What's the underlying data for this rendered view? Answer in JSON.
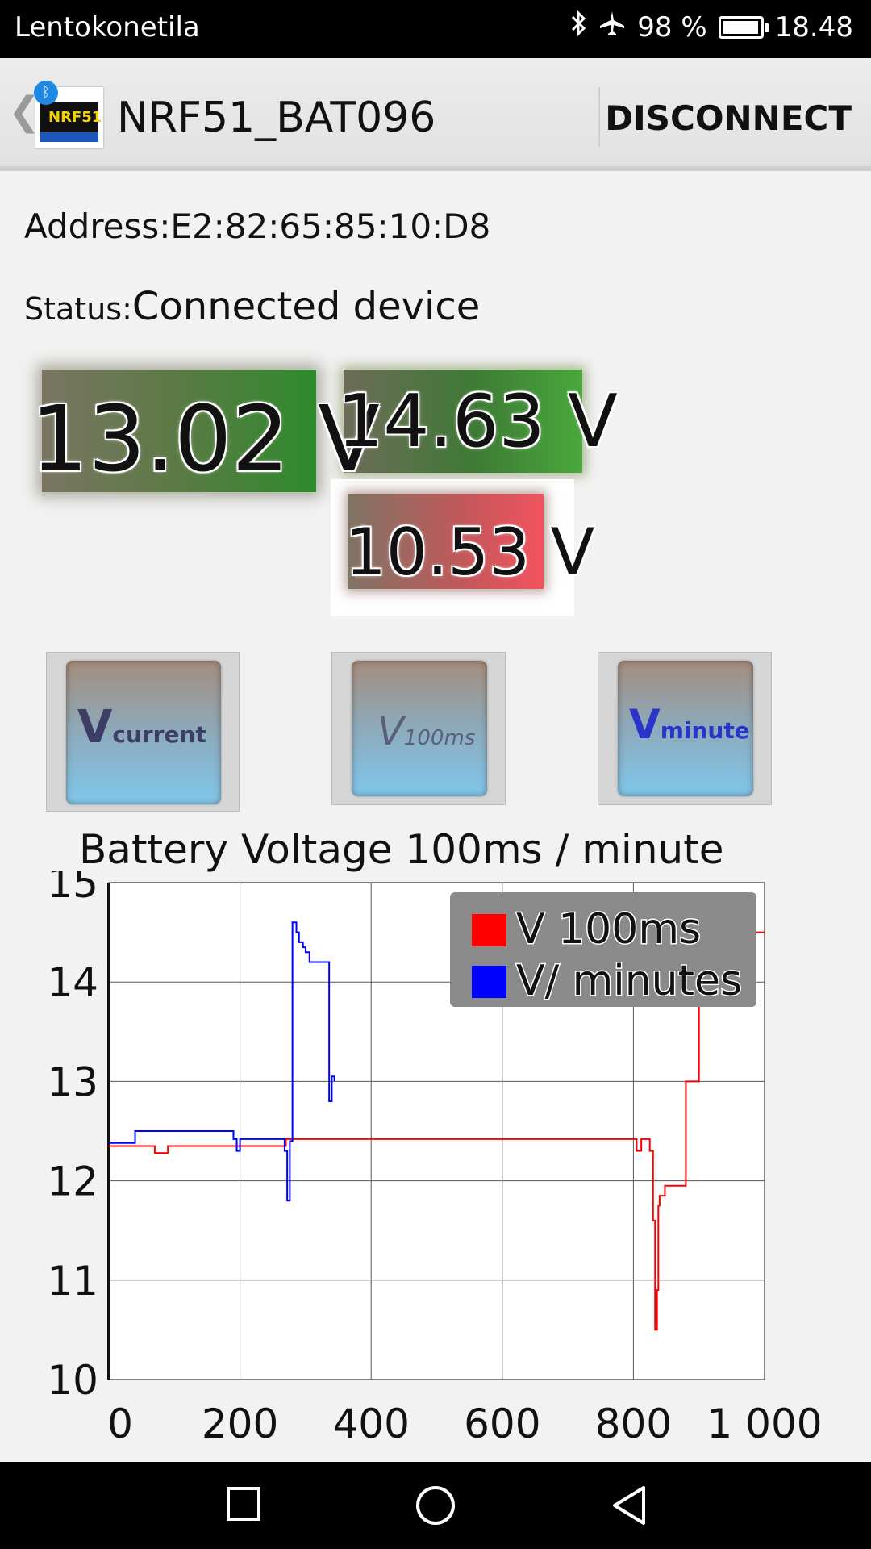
{
  "status_bar": {
    "mode_text": "Lentokonetila",
    "battery_percent": "98 %",
    "battery_level": 0.98,
    "time": "18.48"
  },
  "action_bar": {
    "app_icon_label": "NRF51",
    "title": "NRF51_BAT096",
    "disconnect_label": "DISCONNECT"
  },
  "info": {
    "address": "Address:E2:82:65:85:10:D8",
    "status_label": "Status:",
    "status_value": "Connected device"
  },
  "readings": {
    "current": "13.02 V",
    "max": "14.63 V",
    "min": "10.53 V"
  },
  "mode_buttons": {
    "vcurrent": {
      "big": "V",
      "small": "current"
    },
    "v100ms": {
      "big": "V",
      "small": "100ms"
    },
    "vminute": {
      "big": "V",
      "small": "minute"
    }
  },
  "chart_data": {
    "type": "line",
    "title": "Battery Voltage 100ms / minute",
    "xlabel": "",
    "ylabel": "",
    "xlim": [
      0,
      1000
    ],
    "ylim": [
      10,
      15
    ],
    "x_ticks": [
      "0",
      "200",
      "400",
      "600",
      "800",
      "1 000"
    ],
    "y_ticks": [
      "15",
      "14",
      "13",
      "12",
      "11",
      "10"
    ],
    "grid": true,
    "legend_position": "top-right",
    "series": [
      {
        "name": "V 100ms",
        "color": "#ff0000",
        "x": [
          0,
          60,
          70,
          90,
          180,
          200,
          220,
          270,
          400,
          600,
          800,
          805,
          812,
          820,
          825,
          830,
          833,
          836,
          838,
          840,
          848,
          862,
          880,
          900,
          910,
          920,
          950,
          960,
          980,
          1000
        ],
        "y": [
          12.35,
          12.35,
          12.28,
          12.35,
          12.35,
          12.35,
          12.35,
          12.42,
          12.42,
          12.42,
          12.42,
          12.3,
          12.42,
          12.42,
          12.3,
          11.6,
          10.5,
          10.9,
          11.75,
          11.85,
          11.95,
          11.95,
          13.0,
          14.4,
          14.55,
          14.6,
          14.6,
          14.5,
          14.5,
          14.5
        ]
      },
      {
        "name": "V/ minutes",
        "color": "#0000ff",
        "x": [
          0,
          30,
          40,
          180,
          190,
          195,
          200,
          265,
          268,
          272,
          276,
          280,
          286,
          290,
          296,
          300,
          306,
          330,
          336,
          340,
          344
        ],
        "y": [
          12.38,
          12.38,
          12.5,
          12.5,
          12.42,
          12.3,
          12.42,
          12.42,
          12.3,
          11.8,
          12.4,
          14.6,
          14.5,
          14.4,
          14.35,
          14.3,
          14.2,
          14.2,
          12.8,
          13.05,
          13.0
        ]
      }
    ]
  }
}
